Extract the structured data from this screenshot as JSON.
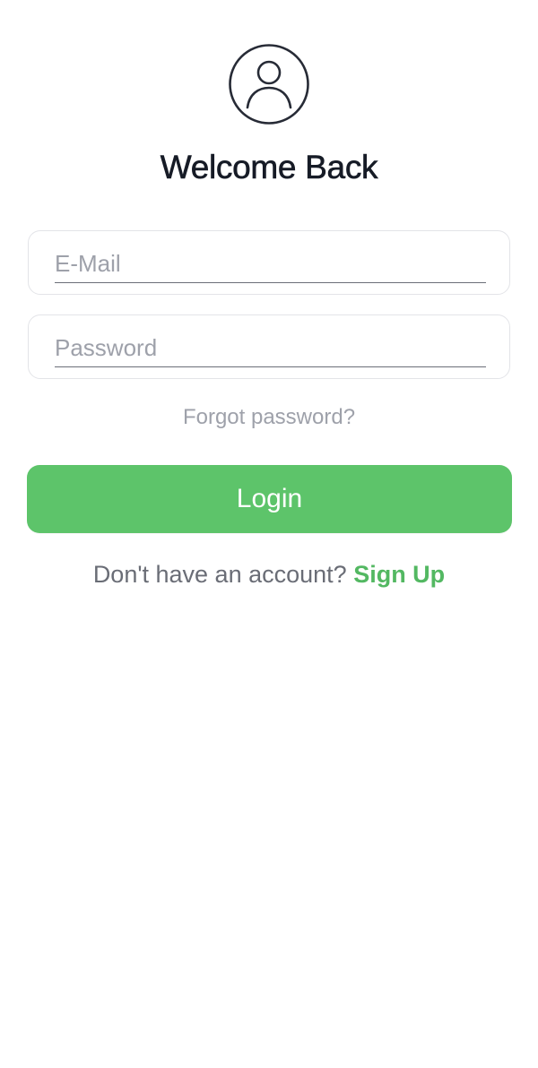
{
  "header": {
    "avatar_icon": "user-circle-icon",
    "title": "Welcome Back"
  },
  "form": {
    "email": {
      "placeholder": "E-Mail",
      "value": ""
    },
    "password": {
      "placeholder": "Password",
      "value": ""
    },
    "forgot_label": "Forgot password?",
    "login_label": "Login"
  },
  "footer": {
    "prompt": "Don't have an account?",
    "signup_label": "Sign Up"
  },
  "colors": {
    "accent": "#5dc46a",
    "link": "#53b862",
    "muted": "#9ea1aa",
    "title": "#161b26"
  }
}
